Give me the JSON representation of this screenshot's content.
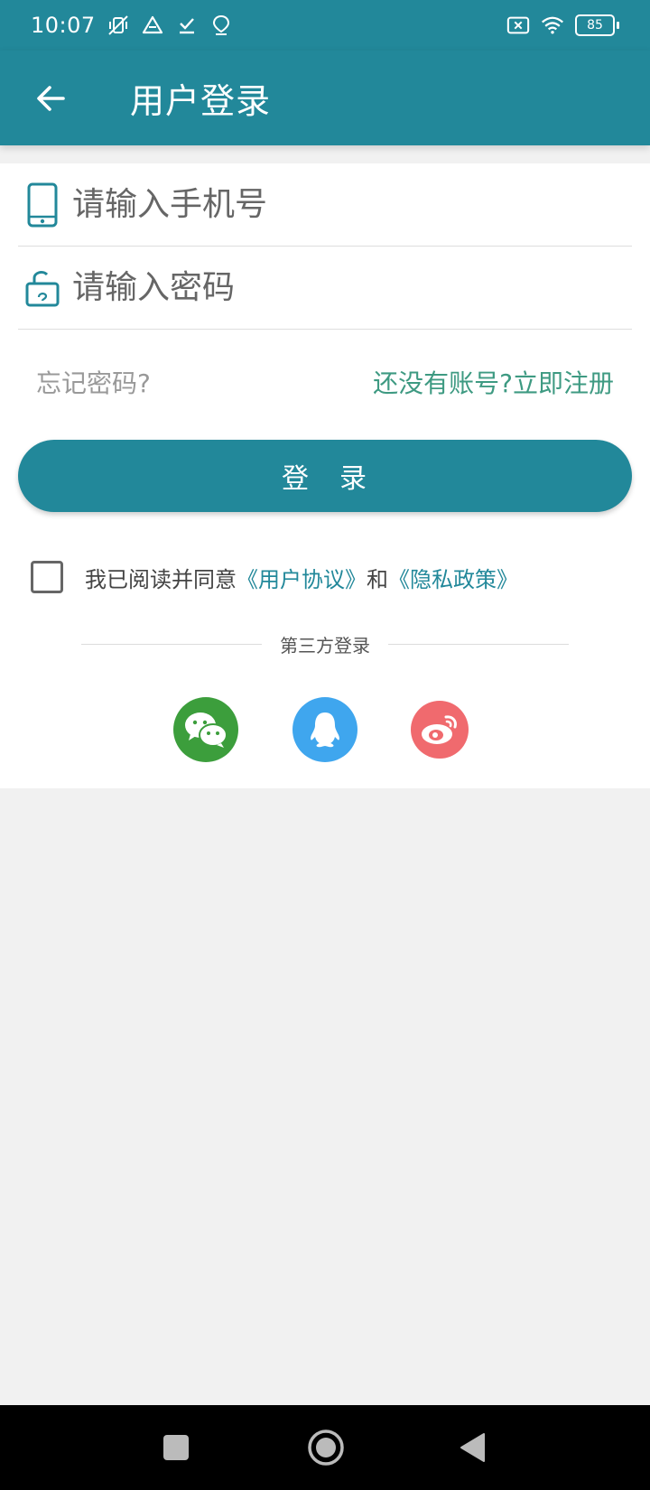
{
  "status_bar": {
    "time": "10:07",
    "battery": "85"
  },
  "app_bar": {
    "title": "用户登录",
    "back_icon": "arrow-left-icon"
  },
  "form": {
    "phone_placeholder": "请输入手机号",
    "phone_value": "",
    "password_placeholder": "请输入密码",
    "password_value": "",
    "forgot_password": "忘记密码?",
    "register_link": "还没有账号?立即注册",
    "login_button": "登　录"
  },
  "agreement": {
    "checked": false,
    "prefix": "我已阅读并同意",
    "user_agreement": "《用户协议》",
    "and": "和",
    "privacy_policy": "《隐私政策》"
  },
  "third_party": {
    "label": "第三方登录",
    "providers": [
      "wechat-icon",
      "qq-icon",
      "weibo-icon"
    ]
  },
  "colors": {
    "primary": "#22889a",
    "register_link": "#3e9a82",
    "wechat": "#3c9e3c",
    "qq": "#3fa6ee",
    "weibo": "#f06a6e"
  }
}
